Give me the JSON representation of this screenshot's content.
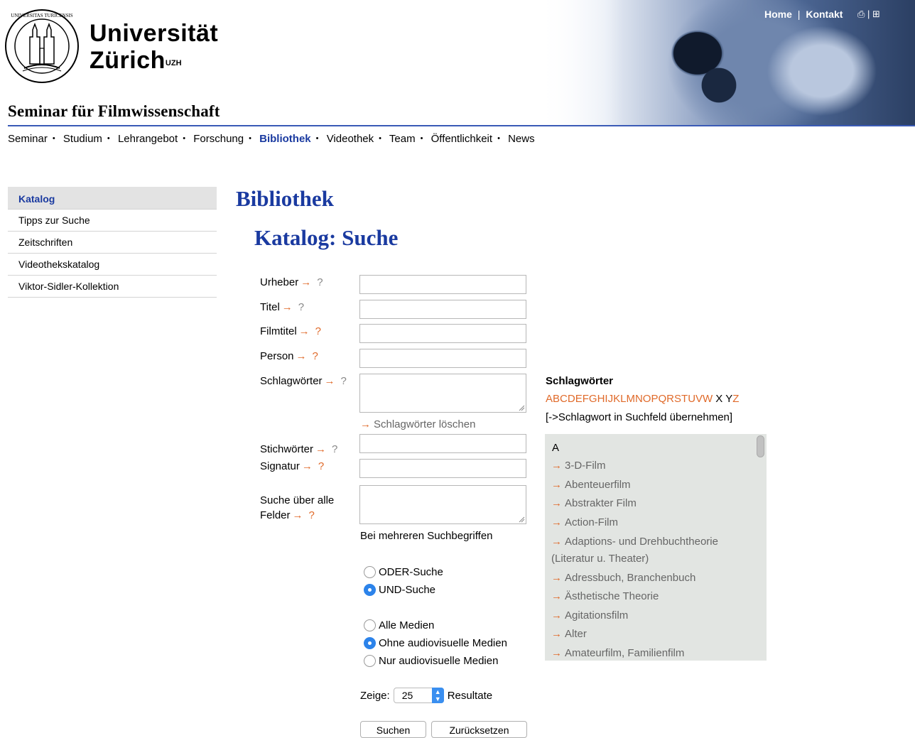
{
  "header": {
    "uni_line1": "Universität",
    "uni_line2": "Zürich",
    "uni_sup": "UZH",
    "top_links": [
      "Home",
      "Kontakt"
    ],
    "top_sep": "|",
    "icons_text": "⎙ | ⊞",
    "seminar_title": "Seminar für Filmwissenschaft"
  },
  "mainnav": {
    "items": [
      "Seminar",
      "Studium",
      "Lehrangebot",
      "Forschung",
      "Bibliothek",
      "Videothek",
      "Team",
      "Öffentlichkeit",
      "News"
    ],
    "separator": "•",
    "active": "Bibliothek"
  },
  "sidenav": {
    "items": [
      "Katalog",
      "Tipps zur Suche",
      "Zeitschriften",
      "Videothekskatalog",
      "Viktor-Sidler-Kollektion"
    ],
    "active": "Katalog"
  },
  "page": {
    "h1": "Bibliothek",
    "h2": "Katalog: Suche"
  },
  "form": {
    "arrow": "→",
    "help": "?",
    "fields": {
      "urheber": "Urheber",
      "titel": "Titel",
      "filmtitel": "Filmtitel",
      "person": "Person",
      "schlagwoerter": "Schlagwörter",
      "stichwoerter": "Stichwörter",
      "signatur": "Signatur",
      "alle_line1": "Suche über alle",
      "alle_line2": "Felder"
    },
    "values": {
      "urheber": "",
      "titel": "",
      "filmtitel": "",
      "person": "",
      "schlagwoerter": "",
      "stichwoerter": "",
      "signatur": "",
      "alle": ""
    },
    "delete_link": "Schlagwörter löschen",
    "multi_note": "Bei mehreren Suchbegriffen",
    "logic_options": [
      "ODER-Suche",
      "UND-Suche"
    ],
    "logic_selected": "UND-Suche",
    "media_options": [
      "Alle Medien",
      "Ohne audiovisuelle Medien",
      "Nur audiovisuelle Medien"
    ],
    "media_selected": "Ohne audiovisuelle Medien",
    "show_label": "Zeige:",
    "show_value": "25",
    "results_label": "Resultate",
    "buttons": {
      "search": "Suchen",
      "reset": "Zurücksetzen"
    }
  },
  "keywords": {
    "title": "Schlagwörter",
    "alphabet": [
      "A",
      "B",
      "C",
      "D",
      "E",
      "F",
      "G",
      "H",
      "I",
      "J",
      "K",
      "L",
      "M",
      "N",
      "O",
      "P",
      "Q",
      "R",
      "S",
      "T",
      "U",
      "V",
      "W",
      "X",
      "Y",
      "Z"
    ],
    "alphabet_inactive": [
      "X",
      "Y"
    ],
    "hint": "[->Schlagwort in Suchfeld übernehmen]",
    "section_head": "A",
    "items": [
      "3-D-Film",
      "Abenteuerfilm",
      "Abstrakter Film",
      "Action-Film",
      "Adaptions- und Drehbuchtheorie",
      "(Literatur u. Theater)",
      "Adressbuch, Branchenbuch",
      "Ästhetische Theorie",
      "Agitationsfilm",
      "Alter",
      "Amateurfilm, Familienfilm"
    ]
  },
  "colors": {
    "accent_blue": "#1a3aa0",
    "arrow_orange": "#e06a2a",
    "keyword_bg": "#e2e5e2"
  }
}
